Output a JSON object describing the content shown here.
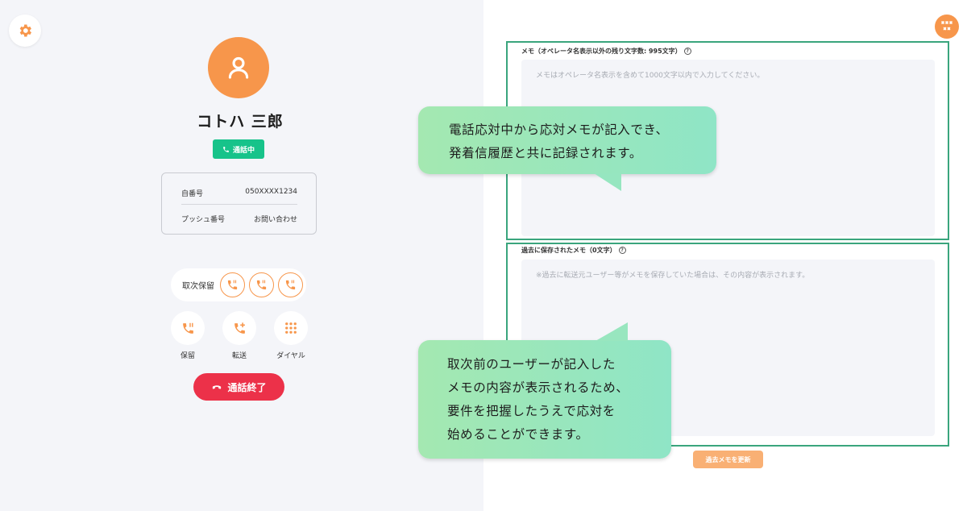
{
  "icons": {
    "settings": "gear-icon",
    "avatar": "user-icon",
    "status": "phone-icon",
    "pickup": "phone-hold-icon",
    "hold": "phone-pause-icon",
    "transfer": "phone-transfer-icon",
    "dial": "dialpad-icon",
    "end": "hangup-icon",
    "logo": "brand-logo-icon"
  },
  "colors": {
    "accent": "#f7964b",
    "status_green": "#17c38a",
    "end_red": "#ec3149",
    "frame_green": "#3aa57d"
  },
  "caller": {
    "name": "コトハ 三郎",
    "status": "通話中"
  },
  "call_info": {
    "rows": [
      {
        "label": "自番号",
        "value": "050XXXX1234"
      },
      {
        "label": "プッシュ番号",
        "value": "お問い合わせ"
      }
    ]
  },
  "pickup": {
    "label": "取次保留"
  },
  "actions": {
    "hold": "保留",
    "transfer": "転送",
    "dial": "ダイヤル",
    "end_call": "通話終了"
  },
  "memo": {
    "label": "メモ（オペレータ名表示以外の残り文字数: 995文字）",
    "placeholder": "メモはオペレータ名表示を含めて1000文字以内で入力してください。"
  },
  "past_memo": {
    "label": "過去に保存されたメモ（0文字）",
    "placeholder": "※過去に転送元ユーザー等がメモを保存していた場合は、その内容が表示されます。",
    "update_button": "過去メモを更新"
  },
  "callouts": {
    "top": [
      "電話応対中から応対メモが記入でき、",
      "発着信履歴と共に記録されます。"
    ],
    "bottom": [
      "取次前のユーザーが記入した",
      "メモの内容が表示されるため、",
      "要件を把握したうえで応対を",
      "始めることができます。"
    ]
  }
}
